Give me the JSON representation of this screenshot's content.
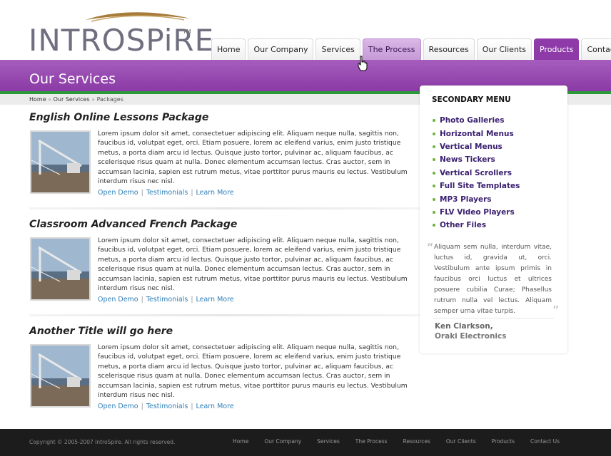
{
  "brand": {
    "name": "INTROSPiRE",
    "tm": "TM"
  },
  "nav": {
    "tabs": [
      {
        "label": "Home"
      },
      {
        "label": "Our Company"
      },
      {
        "label": "Services"
      },
      {
        "label": "The Process"
      },
      {
        "label": "Resources"
      },
      {
        "label": "Our Clients"
      },
      {
        "label": "Products"
      },
      {
        "label": "Contact Us"
      }
    ]
  },
  "banner": {
    "title": "Our Services"
  },
  "breadcrumb": {
    "home": "Home",
    "sep": "»",
    "section": "Our Services",
    "current": "Packages"
  },
  "packages": [
    {
      "title": "English Online Lessons Package",
      "body": "Lorem ipsum dolor sit amet, consectetuer adipiscing elit. Aliquam neque nulla, sagittis non, faucibus id, volutpat eget, orci. Etiam posuere, lorem ac eleifend varius, enim justo tristique metus, a porta diam arcu id lectus. Quisque justo tortor, pulvinar ac, aliquam faucibus, ac scelerisque risus quam at nulla. Donec elementum accumsan lectus. Cras auctor, sem in accumsan lacinia, sapien est rutrum metus, vitae porttitor purus mauris eu lectus. Vestibulum interdum risus nec nisl.",
      "links": [
        "Open Demo",
        "Testimonials",
        "Learn More"
      ]
    },
    {
      "title": "Classroom Advanced French Package",
      "body": "Lorem ipsum dolor sit amet, consectetuer adipiscing elit. Aliquam neque nulla, sagittis non, faucibus id, volutpat eget, orci. Etiam posuere, lorem ac eleifend varius, enim justo tristique metus, a porta diam arcu id lectus. Quisque justo tortor, pulvinar ac, aliquam faucibus, ac scelerisque risus quam at nulla. Donec elementum accumsan lectus. Cras auctor, sem in accumsan lacinia, sapien est rutrum metus, vitae porttitor purus mauris eu lectus. Vestibulum interdum risus nec nisl.",
      "links": [
        "Open Demo",
        "Testimonials",
        "Learn More"
      ]
    },
    {
      "title": "Another Title will go here",
      "body": "Lorem ipsum dolor sit amet, consectetuer adipiscing elit. Aliquam neque nulla, sagittis non, faucibus id, volutpat eget, orci. Etiam posuere, lorem ac eleifend varius, enim justo tristique metus, a porta diam arcu id lectus. Quisque justo tortor, pulvinar ac, aliquam faucibus, ac scelerisque risus quam at nulla. Donec elementum accumsan lectus. Cras auctor, sem in accumsan lacinia, sapien est rutrum metus, vitae porttitor purus mauris eu lectus. Vestibulum interdum risus nec nisl.",
      "links": [
        "Open Demo",
        "Testimonials",
        "Learn More"
      ]
    }
  ],
  "sidebar": {
    "title": "SECONDARY MENU",
    "items": [
      {
        "label": "Photo Galleries"
      },
      {
        "label": "Horizontal Menus"
      },
      {
        "label": "Vertical Menus"
      },
      {
        "label": "News Tickers"
      },
      {
        "label": "Vertical Scrollers"
      },
      {
        "label": "Full Site Templates"
      },
      {
        "label": "MP3 Players"
      },
      {
        "label": "FLV Video Players"
      },
      {
        "label": "Other Files"
      }
    ],
    "quote": {
      "text": "Aliquam sem nulla, interdum vitae, luctus id, gravida ut, orci. Vestibulum ante ipsum primis in faucibus orci luctus et ultrices posuere cubilia Curae; Phasellus rutrum nulla vel lectus. Aliquam semper urna vitae turpis.",
      "author": "Ken Clarkson,",
      "company": "Oraki Electronics"
    }
  },
  "footer": {
    "copyright": "Copyright © 2005-2007 IntroSpire. All rights reserved.",
    "links": [
      "Home",
      "Our Company",
      "Services",
      "The Process",
      "Resources",
      "Our Clients",
      "Products",
      "Contact Us"
    ]
  },
  "colors": {
    "brand_purple": "#8e3ba9",
    "accent_green": "#2a9a3a",
    "link_blue": "#2f7fb8",
    "footer_bg": "#1c1c1c"
  }
}
